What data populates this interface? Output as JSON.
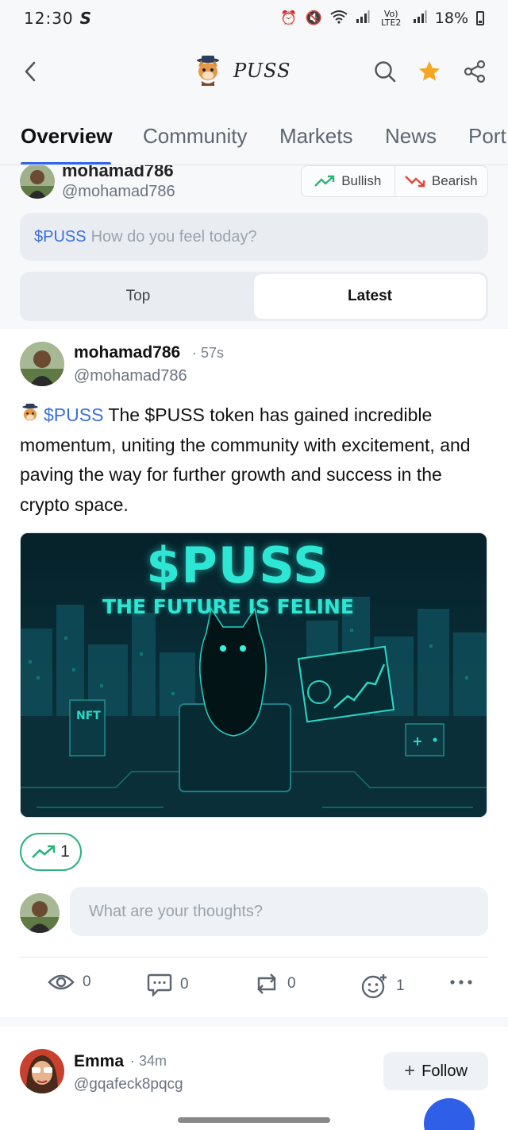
{
  "status_bar": {
    "time": "12:30",
    "carrier_glyph": "S",
    "network": "Vo) LTE2",
    "battery": "18%"
  },
  "header": {
    "title": "PUSS",
    "icons": [
      "back-icon",
      "cat-logo",
      "search-icon",
      "star-icon",
      "share-icon"
    ],
    "star_color": "#f5a623"
  },
  "tabs": [
    {
      "label": "Overview",
      "active": true
    },
    {
      "label": "Community",
      "active": false
    },
    {
      "label": "Markets",
      "active": false
    },
    {
      "label": "News",
      "active": false
    },
    {
      "label": "Port",
      "active": false
    }
  ],
  "compose": {
    "user_name": "mohamad786",
    "user_handle": "@mohamad786",
    "bullish_label": "Bullish",
    "bearish_label": "Bearish",
    "ticker": "$PUSS",
    "placeholder": "How do you feel today?",
    "sort_options": [
      "Top",
      "Latest"
    ],
    "sort_selected": "Latest"
  },
  "post": {
    "author": "mohamad786",
    "time": "· 57s",
    "handle": "@mohamad786",
    "ticker": "$PUSS",
    "text": " The $PUSS token has gained incredible momentum, uniting the community with excitement, and paving the way for further growth and success in the crypto space.",
    "image": {
      "title": "$PUSS",
      "subtitle": "THE FUTURE IS FELINE",
      "billboard_text": "NFT",
      "accent": "#2ee6d4"
    },
    "bullish_count": "1",
    "reply_placeholder": "What are your thoughts?",
    "actions": {
      "views": "0",
      "comments": "0",
      "reposts": "0",
      "reactions": "1"
    }
  },
  "post2": {
    "author": "Emma",
    "time": "· 34m",
    "handle": "@gqafeck8pqcg",
    "follow_label": "Follow"
  },
  "colors": {
    "link_blue": "#3b6fe0",
    "bullish_green": "#2bb37a",
    "bearish_red": "#e0453a",
    "tab_underline": "#3366ee"
  }
}
